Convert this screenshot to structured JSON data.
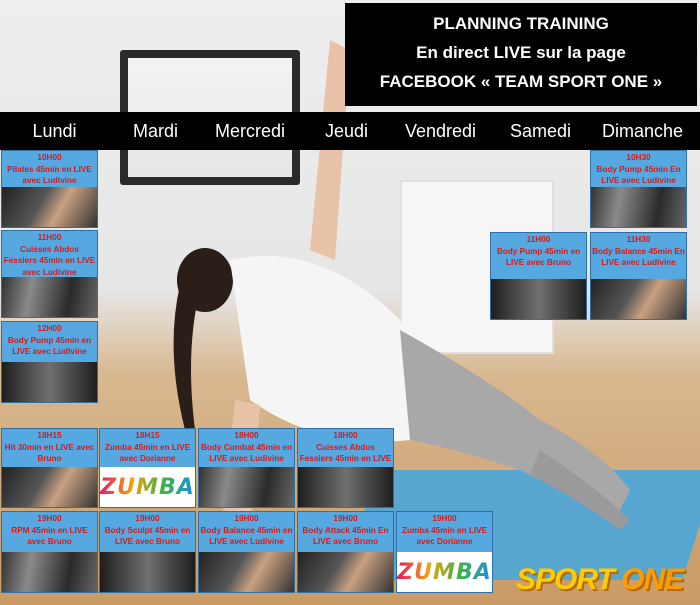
{
  "header": {
    "line1": "PLANNING TRAINING",
    "line2": "En direct LIVE sur la page",
    "line3": "FACEBOOK « TEAM SPORT ONE »"
  },
  "days": [
    "Lundi",
    "Mardi",
    "Mercredi",
    "Jeudi",
    "Vendredi",
    "Samedi",
    "Dimanche"
  ],
  "sessions": [
    {
      "time": "10H00",
      "text": "Pilates 45min en LIVE avec Ludivine"
    },
    {
      "time": "11H00",
      "text": "Cuisses Abdos Fessiers 45min en LIVE avec Ludivine"
    },
    {
      "time": "12H00",
      "text": "Body Pump 45min en LIVE avec Ludivine"
    },
    {
      "time": "18H15",
      "text": "Hit 30min en LIVE avec Bruno"
    },
    {
      "time": "19H00",
      "text": "RPM 45min en LIVE avec Bruno"
    },
    {
      "time": "18H15",
      "text": "Zumba 45min en LIVE avec Dorianne"
    },
    {
      "time": "19H00",
      "text": "Body Sculpt 45min en LIVE avec Bruno"
    },
    {
      "time": "18H00",
      "text": "Body Combat 45min en LIVE avec Ludivine"
    },
    {
      "time": "19H00",
      "text": "Body Balance 45min en LIVE avec Ludivine"
    },
    {
      "time": "18H00",
      "text": "Cuisses Abdos Fessiers 45min en LIVE Bruno"
    },
    {
      "time": "19H00",
      "text": "Body Attack 45min En LIVE avec Bruno"
    },
    {
      "time": "19H00",
      "text": "Zumba 45min en LIVE avec Dorianne"
    },
    {
      "time": "11H00",
      "text": "Body Pump 45min en LIVE avec Bruno"
    },
    {
      "time": "11H30",
      "text": "Body Balance 45min En LIVE avec Ludivine"
    },
    {
      "time": "10H30",
      "text": "Body Pump 45min En LIVE avec Ludivine"
    }
  ],
  "zumba_logo": "ZUMBA",
  "brand": {
    "part1": "SPORT ",
    "part2": "ONE"
  }
}
